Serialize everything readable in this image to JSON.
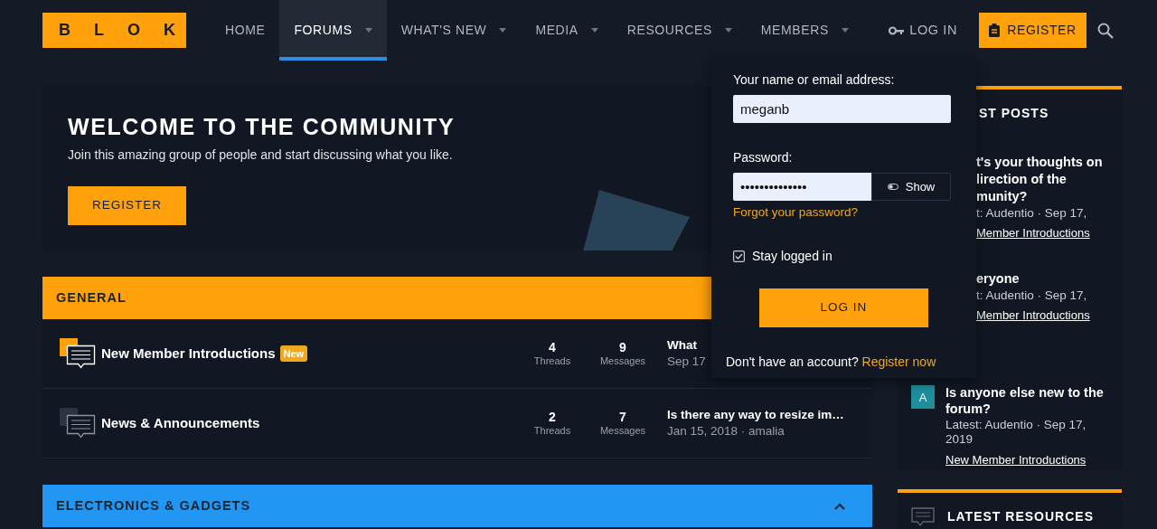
{
  "logo": "BLOK",
  "nav": [
    {
      "label": "HOME",
      "selected": false,
      "has_menu": false
    },
    {
      "label": "FORUMS",
      "selected": true,
      "has_menu": true
    },
    {
      "label": "WHAT'S NEW",
      "selected": false,
      "has_menu": true
    },
    {
      "label": "MEDIA",
      "selected": false,
      "has_menu": true
    },
    {
      "label": "RESOURCES",
      "selected": false,
      "has_menu": true
    },
    {
      "label": "MEMBERS",
      "selected": false,
      "has_menu": true
    }
  ],
  "account": {
    "login": "LOG IN",
    "register": "REGISTER"
  },
  "welcome": {
    "title": "WELCOME TO THE COMMUNITY",
    "subtitle": "Join this amazing group of people and start discussing what you like.",
    "button": "REGISTER"
  },
  "categories": [
    {
      "title": "GENERAL",
      "color": "#ffa10a",
      "forums": [
        {
          "title": "New Member Introductions",
          "badge": "New",
          "unread": true,
          "threads": "4",
          "threads_label": "Threads",
          "messages": "9",
          "messages_label": "Messages",
          "last_title": "What",
          "last_meta": "Sep 17"
        },
        {
          "title": "News & Announcements",
          "unread": false,
          "threads": "2",
          "threads_label": "Threads",
          "messages": "7",
          "messages_label": "Messages",
          "last_title": "Is there any way to resize im…",
          "last_meta": "Jan 15, 2018 · amalia"
        }
      ]
    },
    {
      "title": "ELECTRONICS & GADGETS",
      "color": "#2196f3",
      "expanded": true
    }
  ],
  "sidebar": {
    "latest_posts": {
      "title": "ST POSTS",
      "posts": [
        {
          "kind": "partial",
          "title": "t's your thoughts on lirection of the munity?",
          "meta": "t: Audentio · Sep 17,",
          "forum": "Member Introductions"
        },
        {
          "kind": "partial",
          "title": "eryone",
          "meta": "t: Audentio · Sep 17,",
          "forum": "Member Introductions"
        },
        {
          "kind": "full",
          "avatar": "A",
          "title": "Is anyone else new to the forum?",
          "meta": "Latest: Audentio · Sep 17, 2019",
          "forum": "New Member Introductions"
        }
      ]
    },
    "latest_resources": {
      "title": "LATEST RESOURCES"
    }
  },
  "login_menu": {
    "email_label": "Your name or email address:",
    "email_value": "meganb",
    "password_label": "Password:",
    "password_value": "••••••••••••••",
    "show_label": "Show",
    "forgot": "Forgot your password?",
    "stay_logged_in": {
      "label": "Stay logged in",
      "checked": true
    },
    "submit": "LOG IN",
    "signup_prompt": "Don't have an account?",
    "signup_link": "Register now"
  }
}
